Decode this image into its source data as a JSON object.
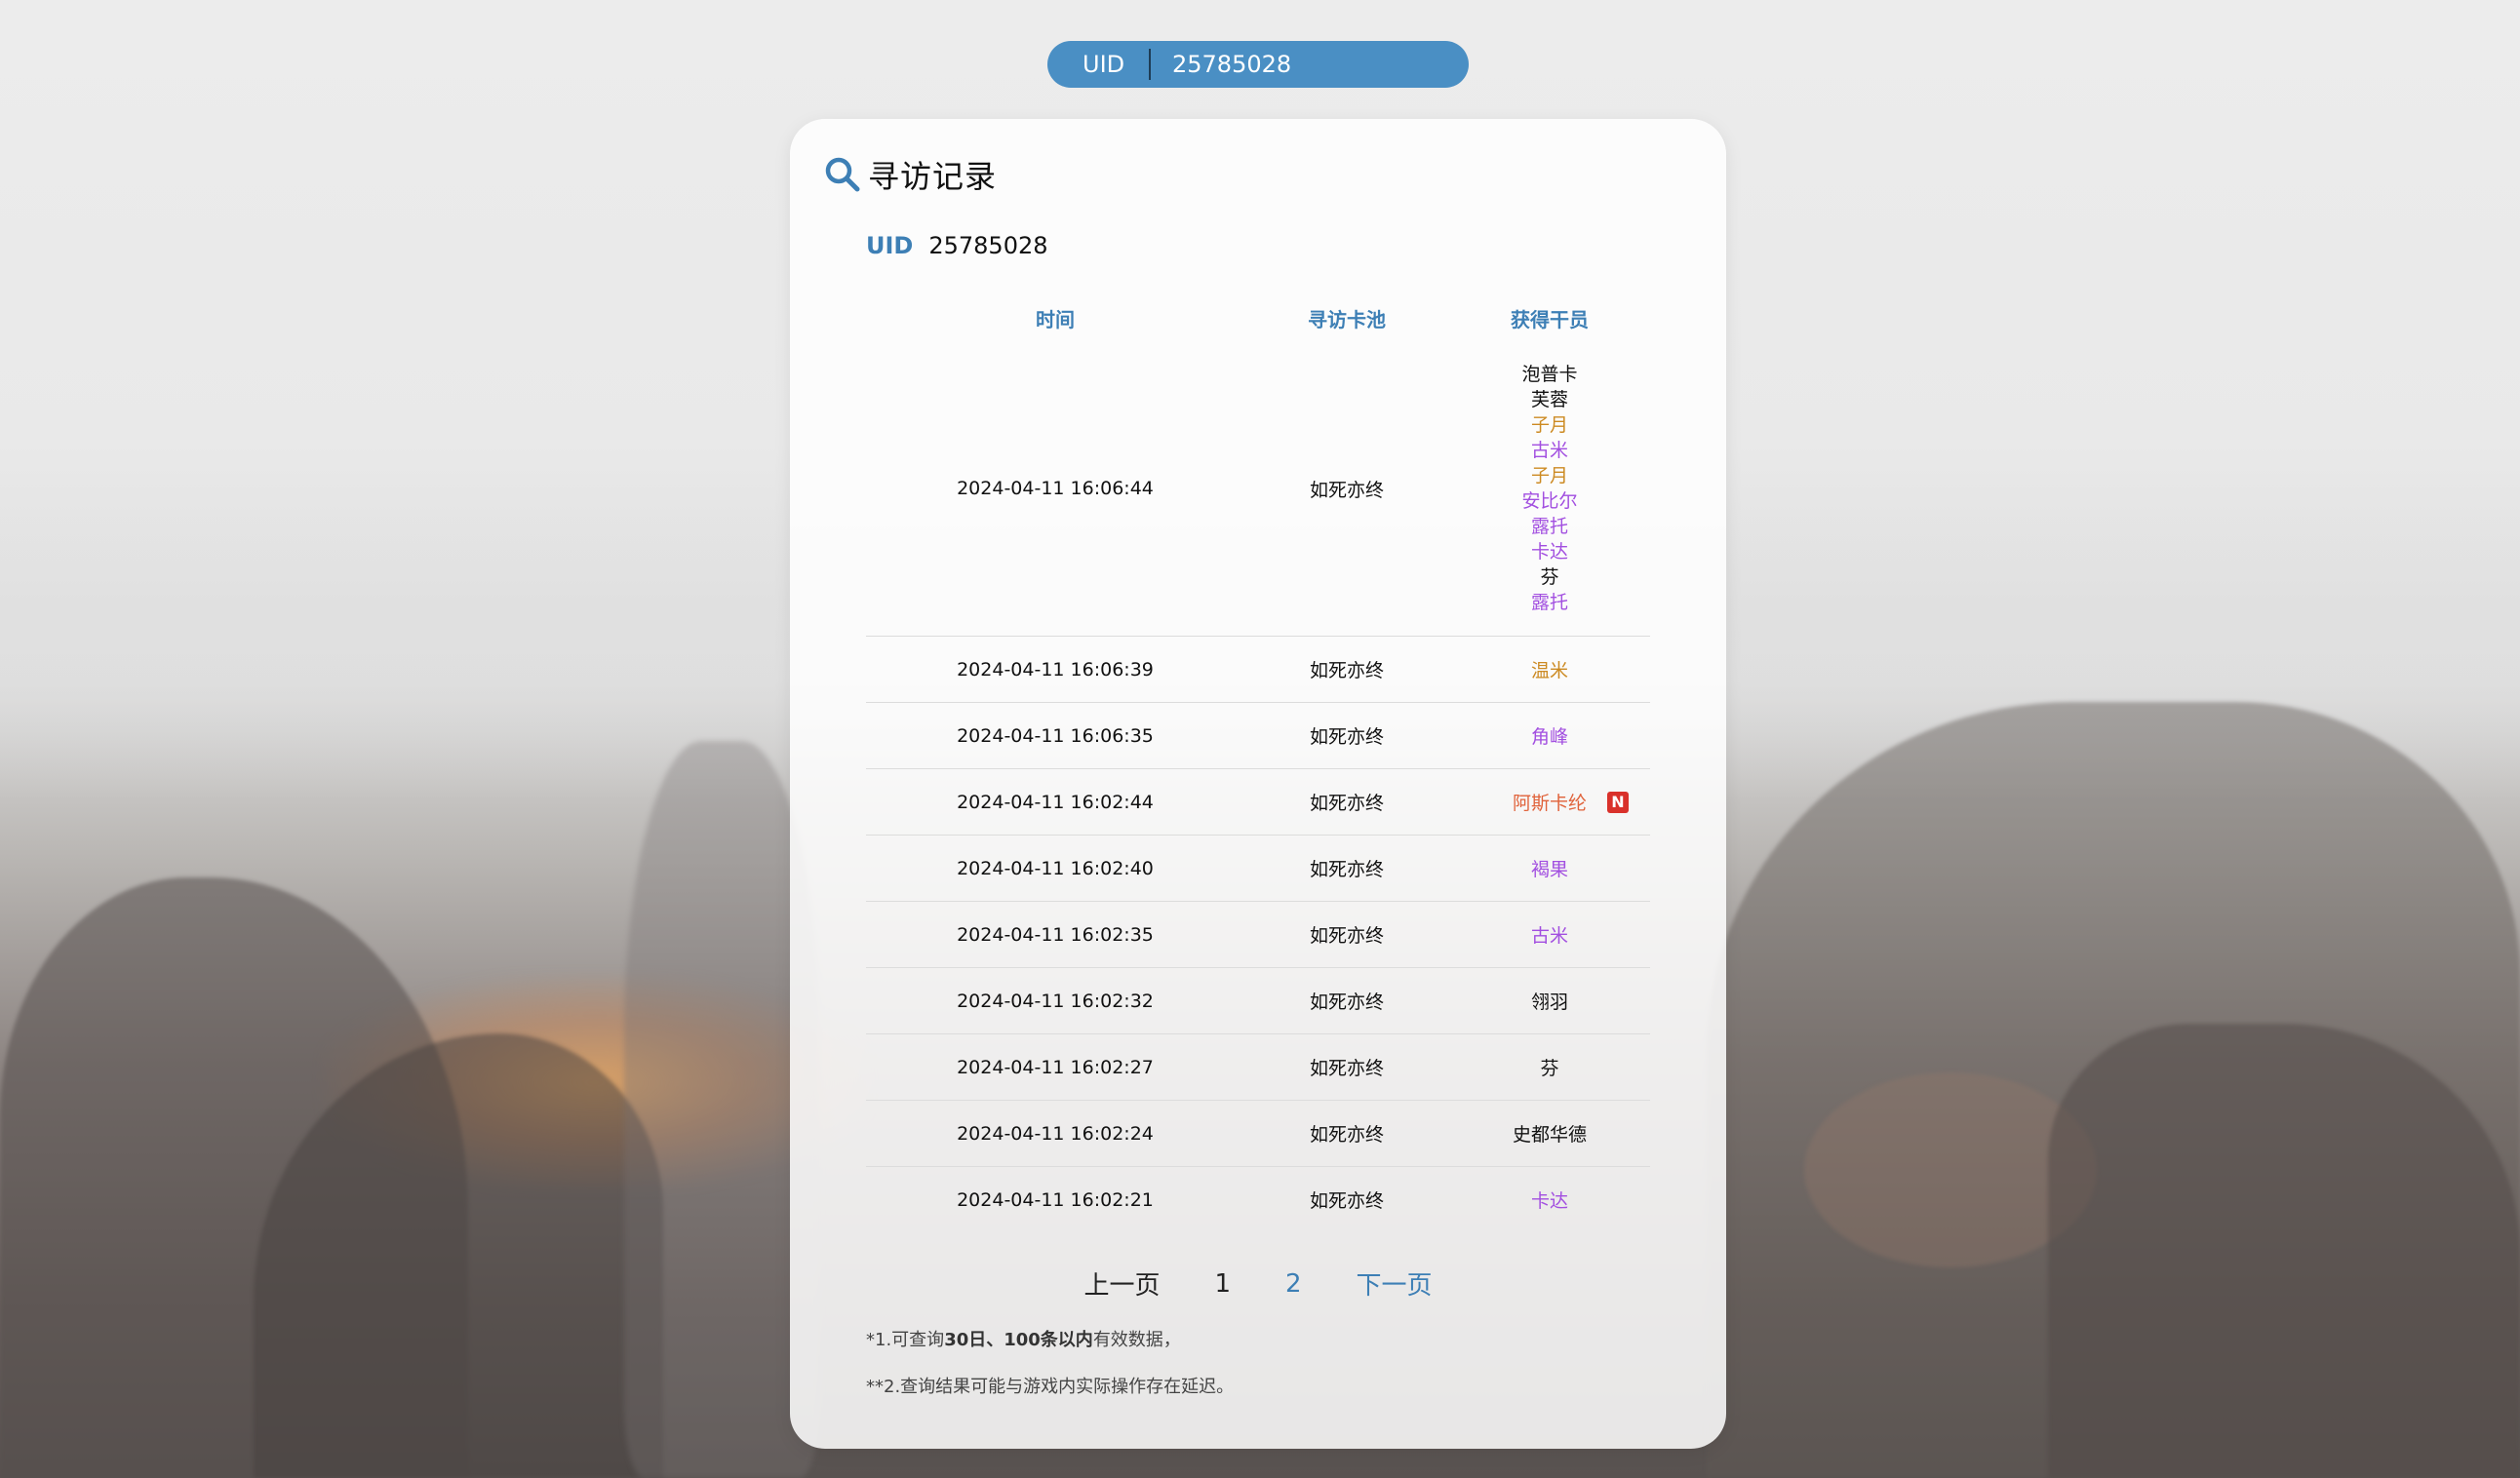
{
  "top_uid": {
    "label": "UID",
    "value": "25785028"
  },
  "card": {
    "title": "寻访记录",
    "uid_label": "UID",
    "uid_value": "25785028"
  },
  "table": {
    "headers": {
      "time": "时间",
      "pool": "寻访卡池",
      "operator": "获得干员"
    },
    "rows": [
      {
        "time": "2024-04-11 16:06:44",
        "pool": "如死亦终",
        "operators": [
          {
            "name": "泡普卡",
            "color": "#111111"
          },
          {
            "name": "芙蓉",
            "color": "#111111"
          },
          {
            "name": "子月",
            "color": "#cc8a22"
          },
          {
            "name": "古米",
            "color": "#a24fe0"
          },
          {
            "name": "子月",
            "color": "#cc8a22"
          },
          {
            "name": "安比尔",
            "color": "#a24fe0"
          },
          {
            "name": "露托",
            "color": "#a24fe0"
          },
          {
            "name": "卡达",
            "color": "#a24fe0"
          },
          {
            "name": "芬",
            "color": "#111111"
          },
          {
            "name": "露托",
            "color": "#a24fe0"
          }
        ]
      },
      {
        "time": "2024-04-11 16:06:39",
        "pool": "如死亦终",
        "operator": "温米",
        "color": "#cc8a22"
      },
      {
        "time": "2024-04-11 16:06:35",
        "pool": "如死亦终",
        "operator": "角峰",
        "color": "#a24fe0"
      },
      {
        "time": "2024-04-11 16:02:44",
        "pool": "如死亦终",
        "operator": "阿斯卡纶",
        "color": "#e0623a",
        "badge": "N"
      },
      {
        "time": "2024-04-11 16:02:40",
        "pool": "如死亦终",
        "operator": "褐果",
        "color": "#a24fe0"
      },
      {
        "time": "2024-04-11 16:02:35",
        "pool": "如死亦终",
        "operator": "古米",
        "color": "#a24fe0"
      },
      {
        "time": "2024-04-11 16:02:32",
        "pool": "如死亦终",
        "operator": "翎羽",
        "color": "#111111"
      },
      {
        "time": "2024-04-11 16:02:27",
        "pool": "如死亦终",
        "operator": "芬",
        "color": "#111111"
      },
      {
        "time": "2024-04-11 16:02:24",
        "pool": "如死亦终",
        "operator": "史都华德",
        "color": "#111111"
      },
      {
        "time": "2024-04-11 16:02:21",
        "pool": "如死亦终",
        "operator": "卡达",
        "color": "#a24fe0"
      }
    ]
  },
  "pager": {
    "prev": "上一页",
    "page1": "1",
    "page2": "2",
    "next": "下一页"
  },
  "notes": {
    "n1_pre": "*1.可查询",
    "n1_bold": "30日、100条以内",
    "n1_post": "有效数据，",
    "n2": "**2.查询结果可能与游戏内实际操作存在延迟。"
  },
  "colors": {
    "accent": "#3d7fb5",
    "pill": "#4a8fc4",
    "six_star": "#e0623a",
    "five_star": "#cc8a22",
    "four_star": "#a24fe0",
    "badge": "#d9312b"
  }
}
